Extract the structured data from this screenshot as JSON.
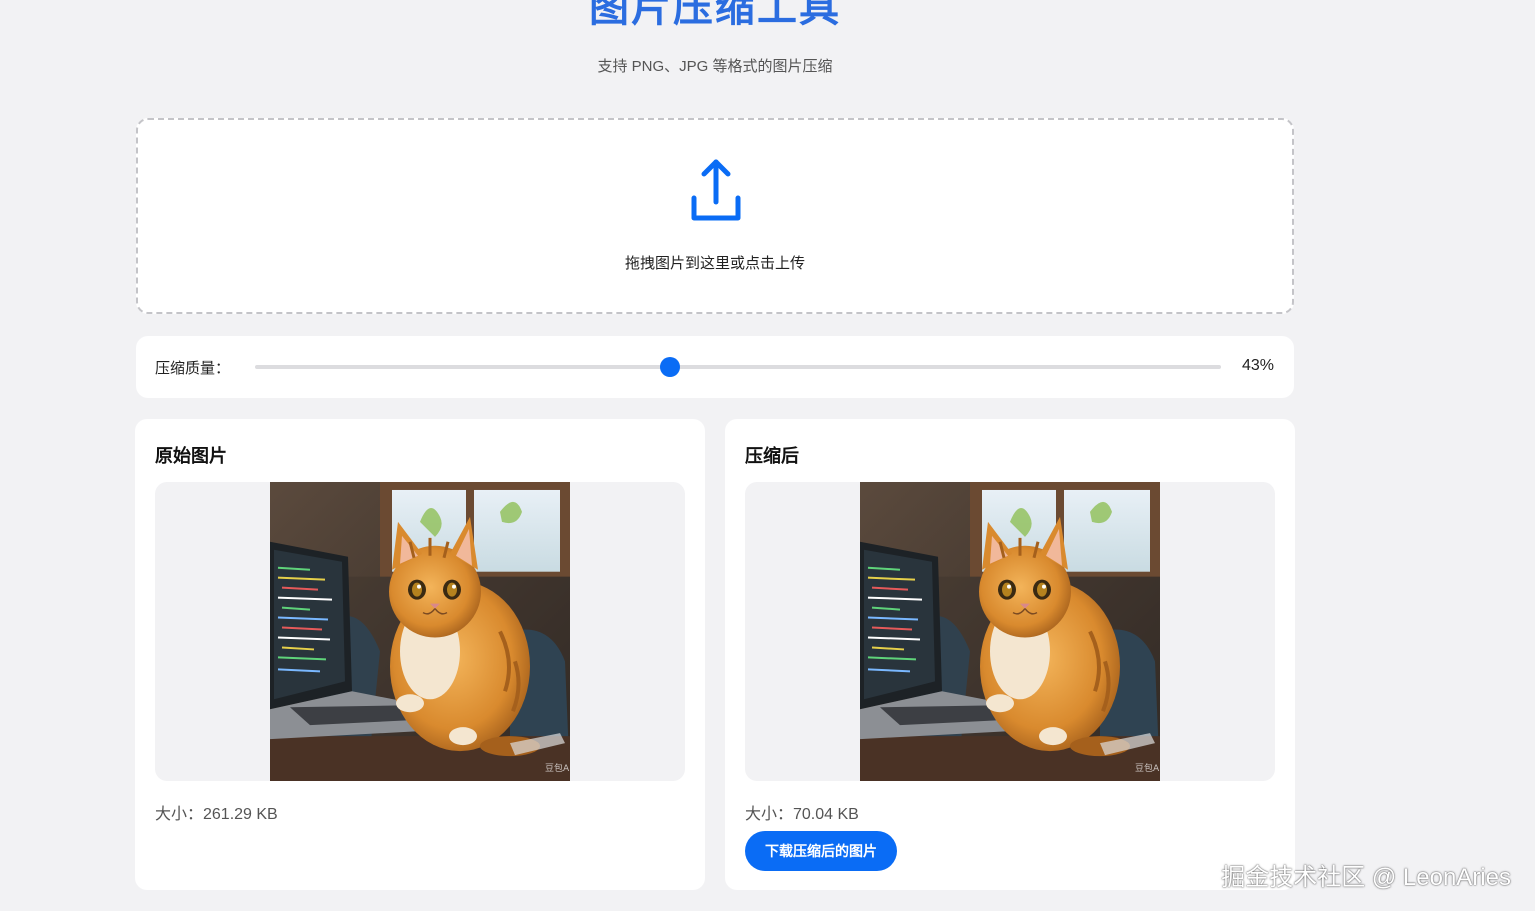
{
  "header": {
    "title": "图片压缩工具",
    "subtitle": "支持 PNG、JPG 等格式的图片压缩"
  },
  "upload": {
    "icon": "upload-icon",
    "label": "拖拽图片到这里或点击上传"
  },
  "quality": {
    "label": "压缩质量：",
    "value": 43,
    "value_text": "43%"
  },
  "original": {
    "title": "原始图片",
    "size_text": "大小：261.29 KB",
    "image_alt": "orange cat sitting next to a laptop"
  },
  "compressed": {
    "title": "压缩后",
    "size_text": "大小：70.04 KB",
    "download_label": "下载压缩后的图片",
    "image_alt": "orange cat sitting next to a laptop"
  },
  "watermark": "掘金技术社区 @ LeonAries",
  "colors": {
    "accent": "#0a6cf5",
    "title": "#2b6de0",
    "background": "#f2f2f4"
  }
}
